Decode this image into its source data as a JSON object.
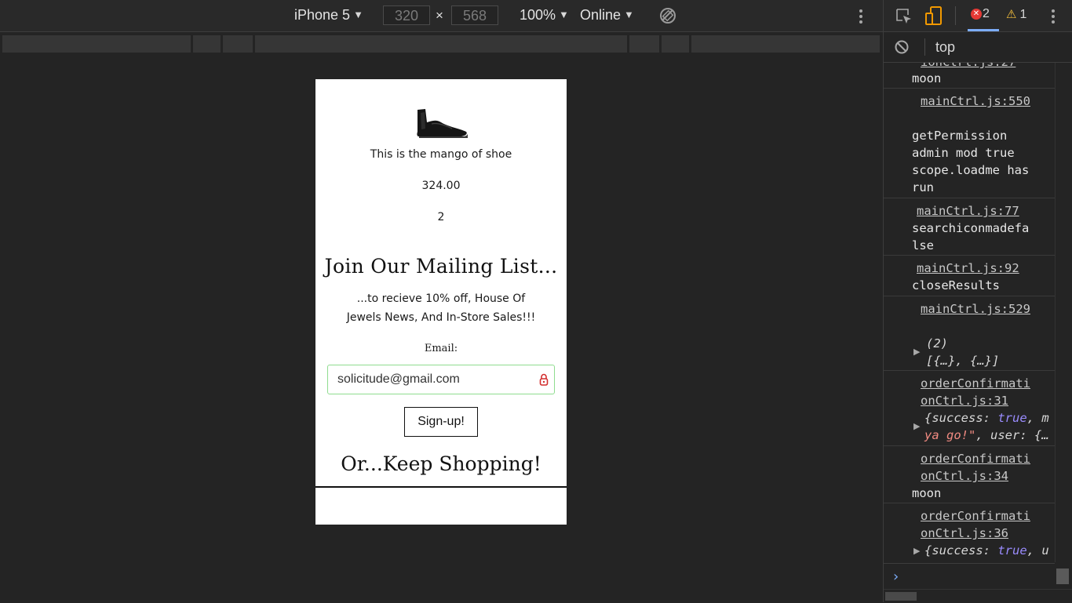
{
  "device_toolbar": {
    "device": "iPhone 5",
    "width": "320",
    "times": "×",
    "height": "568",
    "zoom": "100%",
    "throttling": "Online",
    "dropdown_arrow": "▼"
  },
  "page": {
    "product_description": "This is the mango of shoe",
    "product_price": "324.00",
    "product_quantity": "2",
    "mailing_heading": "Join Our Mailing List...",
    "mailing_subtext": "...to recieve 10% off, House Of Jewels News, And In-Store Sales!!!",
    "email_label": "Email:",
    "email_value": "solicitude@gmail.com",
    "signup_label": "Sign-up!",
    "keep_shopping": "Or...Keep Shopping!"
  },
  "devtools": {
    "error_count": "2",
    "warning_count": "1",
    "context": "top",
    "warning_glyph": "⚠",
    "error_glyph": "✕",
    "prompt_glyph": "›",
    "messages": [
      {
        "source": "ionCtrl.js:27",
        "text": "moon"
      },
      {
        "source": "mainCtrl.js:550",
        "text": "getPermission admin mod true scope.loadme has run"
      },
      {
        "source": "mainCtrl.js:77",
        "text": "searchiconmadefalse"
      },
      {
        "source": "mainCtrl.js:92",
        "text": "closeResults"
      },
      {
        "source": "mainCtrl.js:529",
        "count": "(2)",
        "text": "[{…}, {…}]"
      },
      {
        "source": "orderConfirmationCtrl.js:31",
        "obj_open": "{success: ",
        "obj_true": "true",
        "obj_mid": ", m",
        "obj_str": "ya go!\"",
        "obj_tail": ", user: {…"
      },
      {
        "source": "orderConfirmationCtrl.js:34",
        "text": "moon"
      },
      {
        "source": "orderConfirmationCtrl.js:36",
        "obj_open": "{success: ",
        "obj_true": "true",
        "obj_mid": ", u"
      }
    ]
  },
  "colors": {
    "devtools_bg": "#242424",
    "toolbar_bg": "#292929",
    "error_red": "#e53935",
    "warning_yellow": "#f9c23c",
    "link_blue": "#7cacf8",
    "input_focus_green": "#8fdc8f"
  },
  "icons": [
    "rotate-icon",
    "more-icon",
    "inspect-icon",
    "device-icon",
    "error-icon",
    "warning-icon",
    "clear-console-icon",
    "password-manager-icon",
    "shoe-image",
    "expand-arrow-icon",
    "prompt-icon"
  ]
}
